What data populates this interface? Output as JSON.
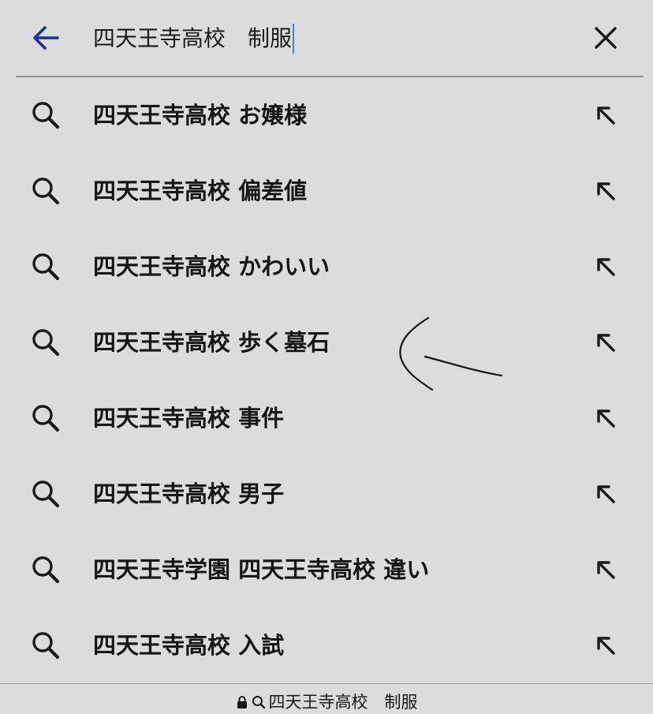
{
  "search": {
    "query": "四天王寺高校　制服",
    "back_icon": "back-arrow-icon",
    "clear_icon": "close-icon",
    "accent_color": "#1f2f8f"
  },
  "suggestions": [
    {
      "label": "四天王寺高校 お嬢様",
      "icon": "search-icon",
      "action_icon": "arrow-up-left-icon"
    },
    {
      "label": "四天王寺高校 偏差値",
      "icon": "search-icon",
      "action_icon": "arrow-up-left-icon"
    },
    {
      "label": "四天王寺高校 かわいい",
      "icon": "search-icon",
      "action_icon": "arrow-up-left-icon"
    },
    {
      "label": "四天王寺高校 歩く墓石",
      "icon": "search-icon",
      "action_icon": "arrow-up-left-icon"
    },
    {
      "label": "四天王寺高校 事件",
      "icon": "search-icon",
      "action_icon": "arrow-up-left-icon"
    },
    {
      "label": "四天王寺高校 男子",
      "icon": "search-icon",
      "action_icon": "arrow-up-left-icon"
    },
    {
      "label": "四天王寺学園 四天王寺高校 違い",
      "icon": "search-icon",
      "action_icon": "arrow-up-left-icon"
    },
    {
      "label": "四天王寺高校 入試",
      "icon": "search-icon",
      "action_icon": "arrow-up-left-icon"
    }
  ],
  "annotation": {
    "icon": "hand-drawn-arrow",
    "points_to": "四天王寺高校 歩く墓石"
  },
  "address_bar": {
    "text": "四天王寺高校　制服",
    "lock_icon": "lock-icon",
    "search_icon": "search-icon"
  }
}
